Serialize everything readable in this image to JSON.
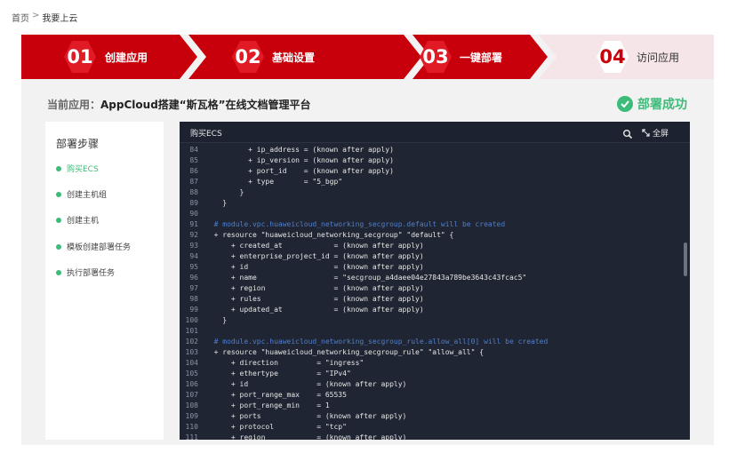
{
  "breadcrumb": {
    "home": "首页",
    "sep": ">",
    "current": "我要上云"
  },
  "steps": [
    {
      "num": "01",
      "label": "创建应用"
    },
    {
      "num": "02",
      "label": "基础设置"
    },
    {
      "num": "03",
      "label": "一键部署"
    },
    {
      "num": "04",
      "label": "访问应用"
    }
  ],
  "app": {
    "prefix": "当前应用：",
    "name": "AppCloud搭建“斯瓦格”在线文档管理平台"
  },
  "status": {
    "label": "部署成功"
  },
  "sidebar": {
    "title": "部署步骤",
    "items": [
      "购买ECS",
      "创建主机组",
      "创建主机",
      "模板创建部署任务",
      "执行部署任务"
    ]
  },
  "terminal": {
    "title": "购买ECS",
    "fullscreen": "全屏",
    "lines": [
      {
        "n": "84",
        "t": "          + ip_address = (known after apply)"
      },
      {
        "n": "85",
        "t": "          + ip_version = (known after apply)"
      },
      {
        "n": "86",
        "t": "          + port_id    = (known after apply)"
      },
      {
        "n": "87",
        "t": "          + type       = \"5_bgp\""
      },
      {
        "n": "88",
        "t": "        }"
      },
      {
        "n": "89",
        "t": "    }"
      },
      {
        "n": "90",
        "t": ""
      },
      {
        "n": "91",
        "t": "  # module.vpc.huaweicloud_networking_secgroup.default will be created",
        "c": true
      },
      {
        "n": "92",
        "t": "  + resource \"huaweicloud_networking_secgroup\" \"default\" {"
      },
      {
        "n": "93",
        "t": "      + created_at            = (known after apply)"
      },
      {
        "n": "94",
        "t": "      + enterprise_project_id = (known after apply)"
      },
      {
        "n": "95",
        "t": "      + id                    = (known after apply)"
      },
      {
        "n": "96",
        "t": "      + name                  = \"secgroup_a4daee04e27843a789be3643c43fcac5\""
      },
      {
        "n": "97",
        "t": "      + region                = (known after apply)"
      },
      {
        "n": "98",
        "t": "      + rules                 = (known after apply)"
      },
      {
        "n": "99",
        "t": "      + updated_at            = (known after apply)"
      },
      {
        "n": "100",
        "t": "    }"
      },
      {
        "n": "101",
        "t": ""
      },
      {
        "n": "102",
        "t": "  # module.vpc.huaweicloud_networking_secgroup_rule.allow_all[0] will be created",
        "c": true
      },
      {
        "n": "103",
        "t": "  + resource \"huaweicloud_networking_secgroup_rule\" \"allow_all\" {"
      },
      {
        "n": "104",
        "t": "      + direction         = \"ingress\""
      },
      {
        "n": "105",
        "t": "      + ethertype         = \"IPv4\""
      },
      {
        "n": "106",
        "t": "      + id                = (known after apply)"
      },
      {
        "n": "107",
        "t": "      + port_range_max    = 65535"
      },
      {
        "n": "108",
        "t": "      + port_range_min    = 1"
      },
      {
        "n": "109",
        "t": "      + ports             = (known after apply)"
      },
      {
        "n": "110",
        "t": "      + protocol          = \"tcp\""
      },
      {
        "n": "111",
        "t": "      + region            = (known after apply)"
      }
    ]
  },
  "colors": {
    "brand_red": "#c7000b",
    "success_green": "#3dbb78",
    "terminal_bg": "#1f2532",
    "comment_blue": "#4f7fd0"
  }
}
